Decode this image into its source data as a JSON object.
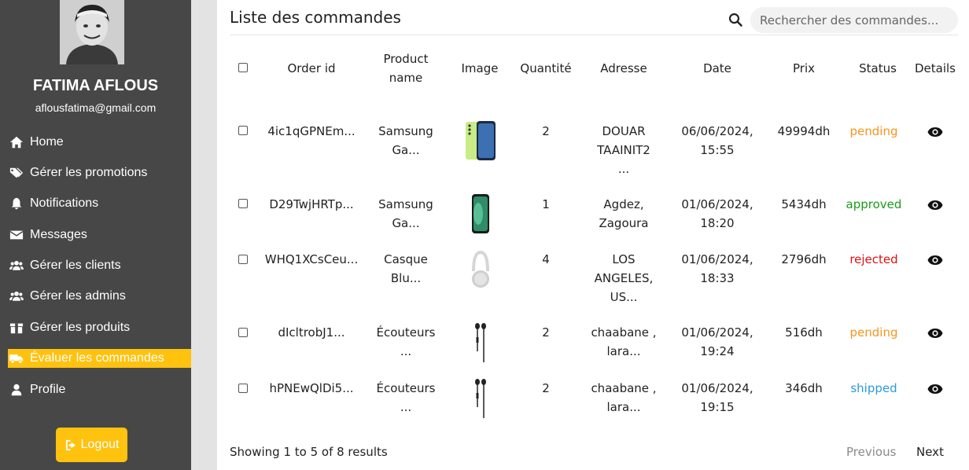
{
  "user": {
    "name": "FATIMA AFLOUS",
    "email": "aflousfatima@gmail.com"
  },
  "sidebar": {
    "items": [
      {
        "label": "Home",
        "icon": "home-icon"
      },
      {
        "label": "Gérer les promotions",
        "icon": "tags-icon"
      },
      {
        "label": "Notifications",
        "icon": "bell-icon"
      },
      {
        "label": "Messages",
        "icon": "envelope-icon"
      },
      {
        "label": "Gérer les clients",
        "icon": "users-icon"
      },
      {
        "label": "Gérer les admins",
        "icon": "users-icon"
      },
      {
        "label": "Gérer les produits",
        "icon": "box-icon"
      },
      {
        "label": "Évaluer les commandes",
        "icon": "truck-icon",
        "active": true
      },
      {
        "label": "Profile",
        "icon": "user-icon"
      }
    ],
    "logout_label": "Logout"
  },
  "main": {
    "title": "Liste des commandes",
    "search_placeholder": "Rechercher des commandes...",
    "columns": {
      "order_id": "Order id",
      "product_line1": "Product",
      "product_line2": "name",
      "image": "Image",
      "quantity": "Quantité",
      "address": "Adresse",
      "date": "Date",
      "price": "Prix",
      "status": "Status",
      "details": "Details"
    },
    "rows": [
      {
        "id": "4ic1qGPNEm...",
        "product": [
          "Samsung",
          "Ga..."
        ],
        "image": "phone-green-icon",
        "qty": "2",
        "address": [
          "DOUAR",
          "TAAINIT2",
          "..."
        ],
        "date": [
          "06/06/2024,",
          "15:55"
        ],
        "price": "49994dh",
        "status": "pending"
      },
      {
        "id": "D29TwjHRTp...",
        "product": [
          "Samsung",
          "Ga..."
        ],
        "image": "phone-black-icon",
        "qty": "1",
        "address": [
          "Agdez,",
          "Zagoura"
        ],
        "date": [
          "01/06/2024,",
          "18:20"
        ],
        "price": "5434dh",
        "status": "approved"
      },
      {
        "id": "WHQ1XCsCeu...",
        "product": [
          "Casque",
          "Blu..."
        ],
        "image": "headphones-icon",
        "qty": "4",
        "address": [
          "LOS",
          "ANGELES,",
          "US..."
        ],
        "date": [
          "01/06/2024,",
          "18:33"
        ],
        "price": "2796dh",
        "status": "rejected"
      },
      {
        "id": "dIcltrobJ1...",
        "product": [
          "Écouteurs",
          "..."
        ],
        "image": "earphones-icon",
        "qty": "2",
        "address": [
          "chaabane ,",
          "lara..."
        ],
        "date": [
          "01/06/2024,",
          "19:24"
        ],
        "price": "516dh",
        "status": "pending"
      },
      {
        "id": "hPNEwQlDi5...",
        "product": [
          "Écouteurs",
          "..."
        ],
        "image": "earphones-icon",
        "qty": "2",
        "address": [
          "chaabane ,",
          "lara..."
        ],
        "date": [
          "01/06/2024,",
          "19:15"
        ],
        "price": "346dh",
        "status": "shipped"
      }
    ],
    "status_colors": {
      "pending": "#f7941d",
      "approved": "#1a9c1a",
      "rejected": "#e01010",
      "shipped": "#2b9be0"
    },
    "footer": "Showing 1 to 5 of 8 results",
    "prev_label": "Previous",
    "next_label": "Next"
  },
  "colors": {
    "sidebar_bg": "#474747",
    "accent": "#ffc20e"
  }
}
